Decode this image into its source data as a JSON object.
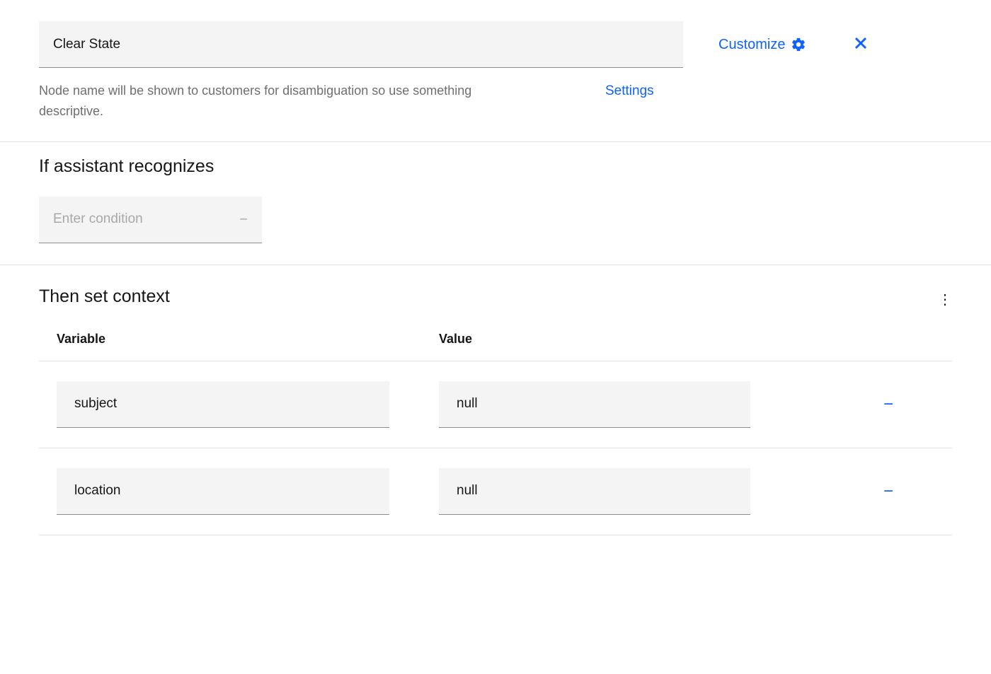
{
  "header": {
    "node_name_value": "Clear State",
    "customize_label": "Customize",
    "helper_text": "Node name will be shown to customers for disambiguation so use something descriptive.",
    "settings_label": "Settings"
  },
  "recognizes": {
    "title": "If assistant recognizes",
    "condition_placeholder": "Enter condition"
  },
  "context": {
    "title": "Then set context",
    "columns": {
      "variable": "Variable",
      "value": "Value"
    },
    "rows": [
      {
        "variable": "subject",
        "value": "null"
      },
      {
        "variable": "location",
        "value": "null"
      }
    ]
  }
}
